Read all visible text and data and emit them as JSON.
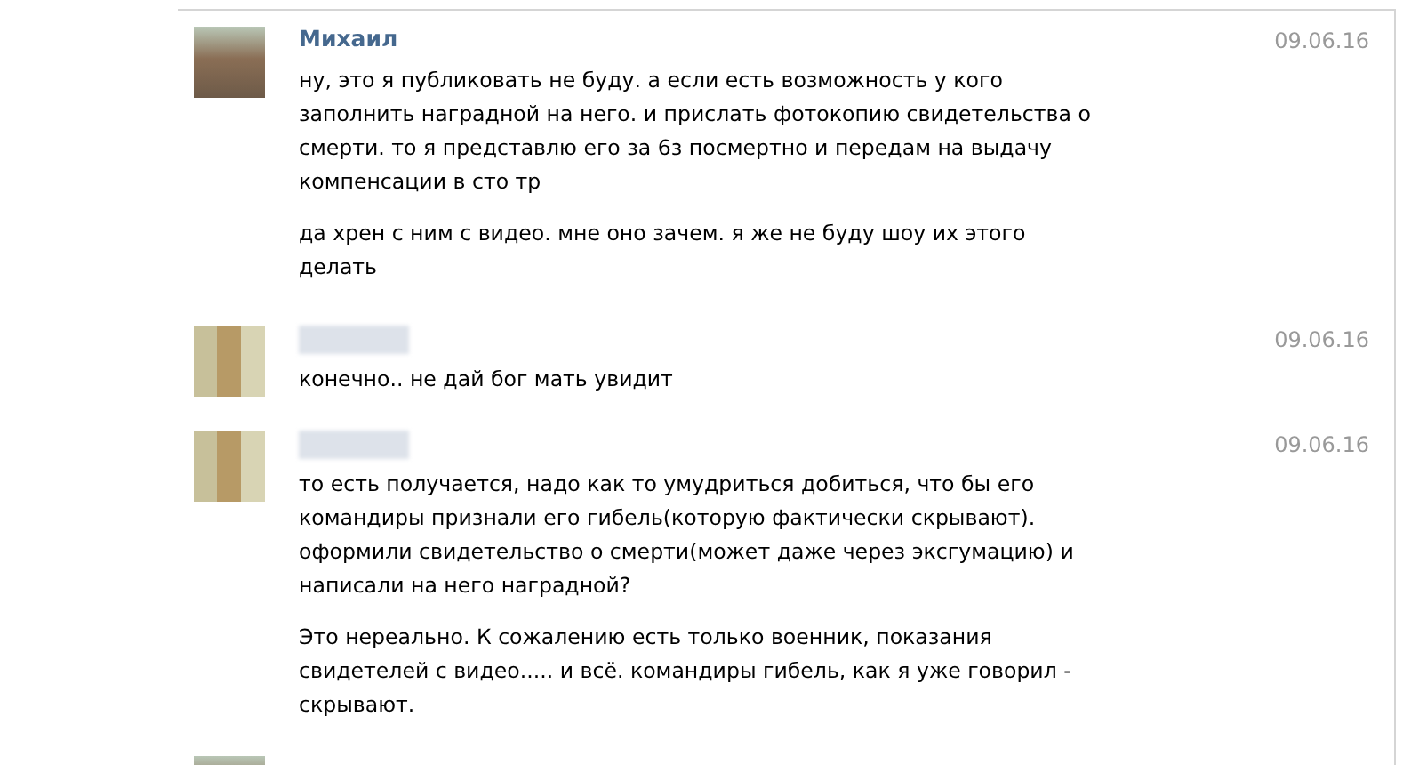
{
  "messages": [
    {
      "avatar_blurred": false,
      "name_hidden": false,
      "name": "Михаил",
      "date": "09.06.16",
      "paragraphs": [
        "ну, это я публиковать не буду. а если есть возможность у кого заполнить наградной на него. и прислать фотокопию свидетельства о смерти. то я представлю его за 6з посмертно и передам на выдачу компенсации в сто тр",
        "да хрен с ним с видео. мне оно зачем. я же не буду шоу их этого делать"
      ]
    },
    {
      "avatar_blurred": true,
      "name_hidden": true,
      "date": "09.06.16",
      "paragraphs": [
        "конечно.. не дай бог мать увидит"
      ]
    },
    {
      "avatar_blurred": true,
      "name_hidden": true,
      "date": "09.06.16",
      "paragraphs": [
        "то есть получается, надо как то умудриться добиться, что бы его командиры признали его гибель(которую фактически скрывают). оформили свидетельство о смерти(может даже через эксгумацию) и написали на него наградной?",
        "Это нереально. К сожалению есть только военник, показания свидетелей с видео..... и всё. командиры гибель, как я уже говорил - скрывают."
      ]
    },
    {
      "avatar_blurred": false
    }
  ]
}
